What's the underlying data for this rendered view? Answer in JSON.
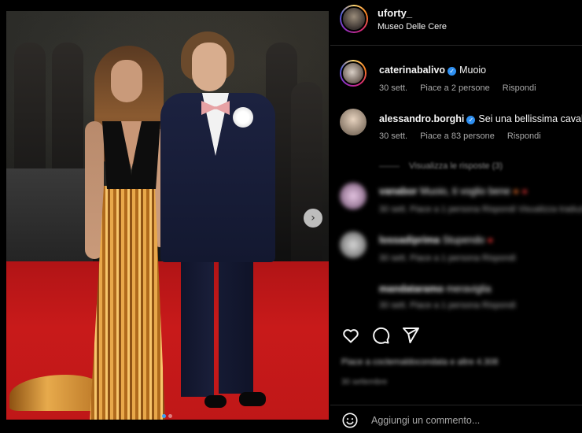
{
  "post": {
    "username": "uforty_",
    "location": "Museo Delle Cere",
    "carousel": {
      "current": 1,
      "total": 2
    }
  },
  "comments": [
    {
      "username": "caterinabalivo",
      "verified": true,
      "text": "Muoio",
      "time": "30 sett.",
      "likes": "Piace a 2 persone",
      "reply": "Rispondi"
    },
    {
      "username": "alessandro.borghi",
      "verified": true,
      "text": "Sei una bellissima caval",
      "time": "30 sett.",
      "likes": "Piace a 83 persone",
      "reply": "Rispondi"
    }
  ],
  "blurred": {
    "view_replies": "Visualizza le risposte (3)",
    "c3_user": "vanabor",
    "c3_text": "Muoio, ti voglio bene",
    "c3_meta": "30 sett.   Piace a 1 persona   Rispondi   Visualizza traduzione",
    "c4_user": "lossadiprima",
    "c4_text": "Stupendo",
    "c4_meta": "30 sett.   Piace a 1 persona   Rispondi",
    "c5_user": "mandataramo",
    "c5_text": "meraviglia",
    "c5_meta": "30 sett.   Piace a 1 persona   Rispondi",
    "liked_by": "Piace a coctemaldocondata e altre 4.308",
    "date": "30 settembre"
  },
  "composer": {
    "placeholder": "Aggiungi un commento..."
  },
  "icons": {
    "next": "chevron-right-icon",
    "like": "heart-icon",
    "comment": "comment-bubble-icon",
    "share": "paper-plane-icon",
    "emoji": "smiley-icon"
  },
  "colors": {
    "background": "#000000",
    "text": "#f5f5f5",
    "muted": "#a8a8a8",
    "verified": "#2e8ff0",
    "carousel_active": "#3ea0f5"
  }
}
